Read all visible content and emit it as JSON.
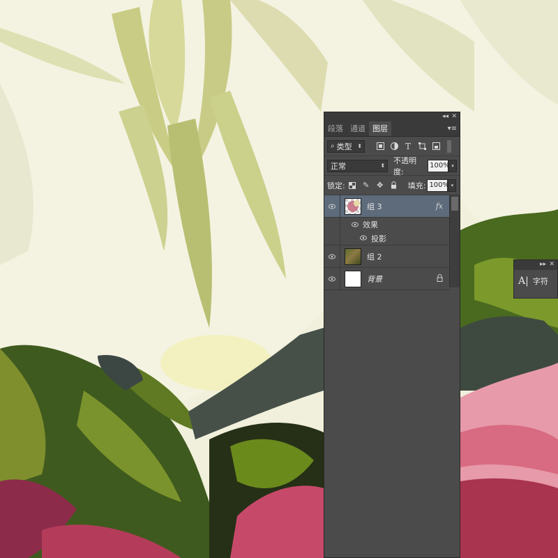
{
  "layers_panel": {
    "tabs": [
      {
        "label": "段落",
        "active": false
      },
      {
        "label": "通道",
        "active": false
      },
      {
        "label": "图层",
        "active": true
      }
    ],
    "filter": {
      "kind_label": "类型"
    },
    "blend_mode": "正常",
    "opacity_label": "不透明度:",
    "opacity_value": "100%",
    "lock_label": "锁定:",
    "fill_label": "填充:",
    "fill_value": "100%",
    "layers": [
      {
        "name": "组 3",
        "selected": true,
        "fx": "fx",
        "effects_label": "效果",
        "effect_items": [
          "投影"
        ]
      },
      {
        "name": "组 2",
        "selected": false
      },
      {
        "name": "背景",
        "selected": false,
        "locked": true
      }
    ]
  },
  "character_panel": {
    "button_glyph": "A|",
    "label": "字符"
  },
  "colors": {
    "panel_bg": "#4b4b4b",
    "selected_layer": "#5d6b7b",
    "canvas_cream": "#efeed8"
  }
}
